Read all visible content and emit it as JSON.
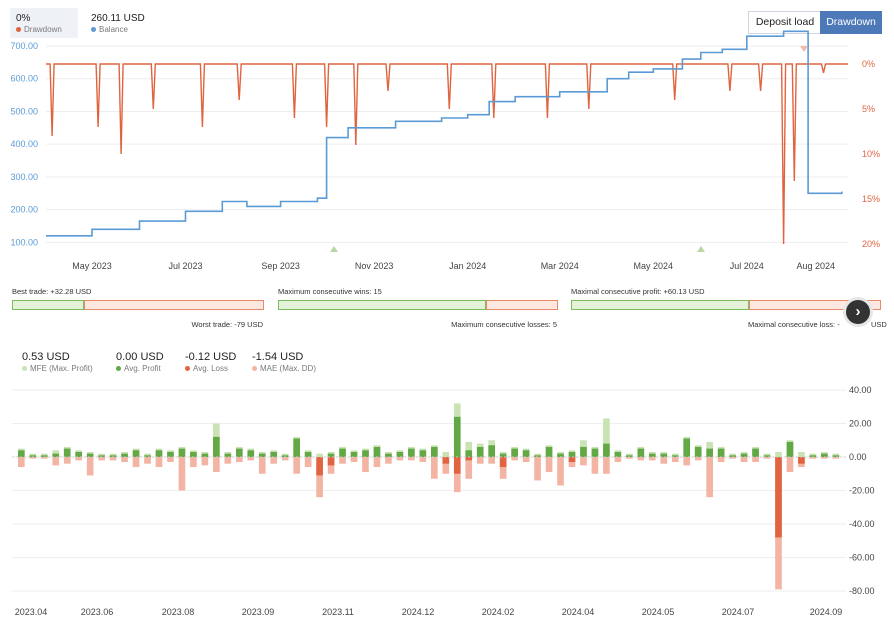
{
  "header": {
    "drawdown": {
      "value": "0%",
      "label": "Drawdown",
      "color": "#e0643f"
    },
    "balance": {
      "value": "260.11 USD",
      "label": "Balance",
      "color": "#5b9bd5"
    },
    "buttons": {
      "deposit_load": "Deposit load",
      "drawdown": "Drawdown",
      "active": "drawdown"
    }
  },
  "stats": {
    "best_trade": "Best trade: +32.28 USD",
    "worst_trade": "Worst trade: -79 USD",
    "max_consec_wins": "Maximum consecutive wins: 15",
    "max_consec_losses": "Maximum consecutive losses: 5",
    "max_consec_profit": "Maximal consecutive profit: +60.13 USD",
    "max_consec_loss": "Maximal consecutive loss: -",
    "max_consec_loss_tail": "USD"
  },
  "summary": [
    {
      "value": "0.53 USD",
      "label": "MFE (Max. Profit)",
      "color": "#c9e3b4"
    },
    {
      "value": "0.00 USD",
      "label": "Avg. Profit",
      "color": "#62a844"
    },
    {
      "value": "-0.12 USD",
      "label": "Avg. Loss",
      "color": "#e0643f"
    },
    {
      "value": "-1.54 USD",
      "label": "MAE (Max. DD)",
      "color": "#f4b4a3"
    }
  ],
  "chart_data": [
    {
      "type": "line",
      "series": [
        {
          "name": "Balance",
          "color": "#5b9bd5",
          "axis": "left",
          "x": [
            "2023-04-01",
            "2023-05-01",
            "2023-06-01",
            "2023-07-01",
            "2023-07-25",
            "2023-08-10",
            "2023-09-01",
            "2023-09-25",
            "2023-10-01",
            "2023-10-15",
            "2023-11-15",
            "2023-12-15",
            "2024-01-01",
            "2024-01-15",
            "2024-02-01",
            "2024-03-01",
            "2024-04-01",
            "2024-04-15",
            "2024-05-01",
            "2024-05-20",
            "2024-06-01",
            "2024-06-15",
            "2024-07-01",
            "2024-07-25",
            "2024-08-01",
            "2024-08-10",
            "2024-08-20",
            "2024-09-01"
          ],
          "y": [
            120,
            140,
            165,
            195,
            225,
            210,
            225,
            235,
            420,
            450,
            470,
            480,
            490,
            530,
            545,
            560,
            600,
            620,
            630,
            660,
            680,
            690,
            730,
            745,
            745,
            250,
            250,
            255
          ]
        },
        {
          "name": "Drawdown",
          "color": "#e0643f",
          "axis": "right",
          "unit": "%",
          "x": [
            "2023-04-05",
            "2023-05-05",
            "2023-05-20",
            "2023-06-10",
            "2023-07-12",
            "2023-08-05",
            "2023-09-10",
            "2023-10-01",
            "2023-10-20",
            "2023-11-10",
            "2023-12-20",
            "2024-01-18",
            "2024-02-22",
            "2024-03-20",
            "2024-05-15",
            "2024-06-20",
            "2024-07-10",
            "2024-07-25",
            "2024-08-01",
            "2024-08-20"
          ],
          "y": [
            8,
            7,
            10,
            5,
            7,
            4,
            6,
            7,
            9,
            3,
            5,
            6,
            6,
            5,
            4,
            3,
            3,
            20,
            13,
            1
          ]
        }
      ],
      "x_ticks": [
        "May 2023",
        "Jul 2023",
        "Sep 2023",
        "Nov 2023",
        "Jan 2024",
        "Mar 2024",
        "May 2024",
        "Jul 2024",
        "Aug 2024"
      ],
      "y_left_ticks": [
        "700.00",
        "600.00",
        "500.00",
        "400.00",
        "300.00",
        "200.00",
        "100.00"
      ],
      "y_right_ticks": [
        "0%",
        "5%",
        "10%",
        "15%",
        "20%"
      ],
      "ylim_left": [
        95,
        700
      ],
      "ylim_right": [
        0,
        20
      ],
      "grid": true
    },
    {
      "type": "bar",
      "series": [
        {
          "name": "MFE (Max. Profit)",
          "color": "#c9e3b4"
        },
        {
          "name": "Avg. Profit",
          "color": "#62a844"
        },
        {
          "name": "Avg. Loss",
          "color": "#e0643f"
        },
        {
          "name": "MAE (Max. DD)",
          "color": "#f4b4a3"
        }
      ],
      "x_ticks": [
        "2023.04",
        "2023.06",
        "2023.08",
        "2023.09",
        "2023.11",
        "2024.12",
        "2024.02",
        "2024.04",
        "2024.05",
        "2024.07",
        "2024.09"
      ],
      "y_ticks": [
        "40.00",
        "20.00",
        "0.00",
        "-20.00",
        "-40.00",
        "-60.00",
        "-80.00"
      ],
      "ylim": [
        -80,
        40
      ],
      "bars": [
        {
          "mfe": 5,
          "profit": 4,
          "loss": 0,
          "mae": -6
        },
        {
          "mfe": 2,
          "profit": 1,
          "loss": 0,
          "mae": -1
        },
        {
          "mfe": 2,
          "profit": 1,
          "loss": 0,
          "mae": -1
        },
        {
          "mfe": 4,
          "profit": 2,
          "loss": 0,
          "mae": -5
        },
        {
          "mfe": 6,
          "profit": 5,
          "loss": 0,
          "mae": -4
        },
        {
          "mfe": 4,
          "profit": 3,
          "loss": 0,
          "mae": -2
        },
        {
          "mfe": 3,
          "profit": 2,
          "loss": 0,
          "mae": -11
        },
        {
          "mfe": 2,
          "profit": 1,
          "loss": 0,
          "mae": -2
        },
        {
          "mfe": 2,
          "profit": 1,
          "loss": 0,
          "mae": -2
        },
        {
          "mfe": 3,
          "profit": 2,
          "loss": 0,
          "mae": -3
        },
        {
          "mfe": 5,
          "profit": 4,
          "loss": 0,
          "mae": -6
        },
        {
          "mfe": 2,
          "profit": 1,
          "loss": 0,
          "mae": -4
        },
        {
          "mfe": 5,
          "profit": 4,
          "loss": 0,
          "mae": -6
        },
        {
          "mfe": 4,
          "profit": 3,
          "loss": 0,
          "mae": -3
        },
        {
          "mfe": 6,
          "profit": 5,
          "loss": 0,
          "mae": -20
        },
        {
          "mfe": 4,
          "profit": 3,
          "loss": 0,
          "mae": -6
        },
        {
          "mfe": 3,
          "profit": 2,
          "loss": 0,
          "mae": -5
        },
        {
          "mfe": 20,
          "profit": 12,
          "loss": 0,
          "mae": -9
        },
        {
          "mfe": 3,
          "profit": 2,
          "loss": 0,
          "mae": -4
        },
        {
          "mfe": 6,
          "profit": 5,
          "loss": 0,
          "mae": -3
        },
        {
          "mfe": 5,
          "profit": 4,
          "loss": 0,
          "mae": -2
        },
        {
          "mfe": 3,
          "profit": 2,
          "loss": 0,
          "mae": -10
        },
        {
          "mfe": 4,
          "profit": 3,
          "loss": 0,
          "mae": -4
        },
        {
          "mfe": 2,
          "profit": 1,
          "loss": 0,
          "mae": -2
        },
        {
          "mfe": 12,
          "profit": 11,
          "loss": 0,
          "mae": -10
        },
        {
          "mfe": 4,
          "profit": 3,
          "loss": 0,
          "mae": -6
        },
        {
          "mfe": 2,
          "profit": 0,
          "loss": -11,
          "mae": -24
        },
        {
          "mfe": 3,
          "profit": 2,
          "loss": -5,
          "mae": -10
        },
        {
          "mfe": 6,
          "profit": 5,
          "loss": 0,
          "mae": -4
        },
        {
          "mfe": 4,
          "profit": 3,
          "loss": 0,
          "mae": -3
        },
        {
          "mfe": 5,
          "profit": 4,
          "loss": 0,
          "mae": -9
        },
        {
          "mfe": 7,
          "profit": 6,
          "loss": 0,
          "mae": -6
        },
        {
          "mfe": 3,
          "profit": 2,
          "loss": 0,
          "mae": -4
        },
        {
          "mfe": 4,
          "profit": 3,
          "loss": 0,
          "mae": -2
        },
        {
          "mfe": 6,
          "profit": 5,
          "loss": 0,
          "mae": -2
        },
        {
          "mfe": 5,
          "profit": 4,
          "loss": 0,
          "mae": -3
        },
        {
          "mfe": 7,
          "profit": 6,
          "loss": 0,
          "mae": -13
        },
        {
          "mfe": 3,
          "profit": 0,
          "loss": -4,
          "mae": -10
        },
        {
          "mfe": 32,
          "profit": 24,
          "loss": -10,
          "mae": -21
        },
        {
          "mfe": 9,
          "profit": 4,
          "loss": -2,
          "mae": -13
        },
        {
          "mfe": 8,
          "profit": 6,
          "loss": 0,
          "mae": -4
        },
        {
          "mfe": 10,
          "profit": 7,
          "loss": 0,
          "mae": -4
        },
        {
          "mfe": 3,
          "profit": 2,
          "loss": -6,
          "mae": -13
        },
        {
          "mfe": 6,
          "profit": 5,
          "loss": 0,
          "mae": -2
        },
        {
          "mfe": 5,
          "profit": 4,
          "loss": 0,
          "mae": -3
        },
        {
          "mfe": 2,
          "profit": 1,
          "loss": 0,
          "mae": -14
        },
        {
          "mfe": 7,
          "profit": 6,
          "loss": 0,
          "mae": -9
        },
        {
          "mfe": 3,
          "profit": 2,
          "loss": 0,
          "mae": -17
        },
        {
          "mfe": 4,
          "profit": 3,
          "loss": -3,
          "mae": -6
        },
        {
          "mfe": 10,
          "profit": 6,
          "loss": 0,
          "mae": -5
        },
        {
          "mfe": 6,
          "profit": 5,
          "loss": 0,
          "mae": -10
        },
        {
          "mfe": 23,
          "profit": 8,
          "loss": 0,
          "mae": -10
        },
        {
          "mfe": 4,
          "profit": 3,
          "loss": 0,
          "mae": -3
        },
        {
          "mfe": 2,
          "profit": 1,
          "loss": 0,
          "mae": -1
        },
        {
          "mfe": 6,
          "profit": 5,
          "loss": 0,
          "mae": -2
        },
        {
          "mfe": 3,
          "profit": 2,
          "loss": 0,
          "mae": -2
        },
        {
          "mfe": 3,
          "profit": 2,
          "loss": 0,
          "mae": -4
        },
        {
          "mfe": 2,
          "profit": 1,
          "loss": 0,
          "mae": -3
        },
        {
          "mfe": 12,
          "profit": 11,
          "loss": 0,
          "mae": -5
        },
        {
          "mfe": 7,
          "profit": 6,
          "loss": 0,
          "mae": -2
        },
        {
          "mfe": 9,
          "profit": 5,
          "loss": 0,
          "mae": -24
        },
        {
          "mfe": 6,
          "profit": 5,
          "loss": 0,
          "mae": -3
        },
        {
          "mfe": 2,
          "profit": 1,
          "loss": 0,
          "mae": -1
        },
        {
          "mfe": 3,
          "profit": 2,
          "loss": 0,
          "mae": -3
        },
        {
          "mfe": 6,
          "profit": 5,
          "loss": 0,
          "mae": -3
        },
        {
          "mfe": 2,
          "profit": 1,
          "loss": 0,
          "mae": -1
        },
        {
          "mfe": 3,
          "profit": 0,
          "loss": -48,
          "mae": -79
        },
        {
          "mfe": 10,
          "profit": 9,
          "loss": 0,
          "mae": -9
        },
        {
          "mfe": 3,
          "profit": 0,
          "loss": -4,
          "mae": -6
        },
        {
          "mfe": 2,
          "profit": 1,
          "loss": 0,
          "mae": -1
        },
        {
          "mfe": 3,
          "profit": 2,
          "loss": 0,
          "mae": -1
        },
        {
          "mfe": 2,
          "profit": 1,
          "loss": 0,
          "mae": -1
        }
      ]
    }
  ]
}
